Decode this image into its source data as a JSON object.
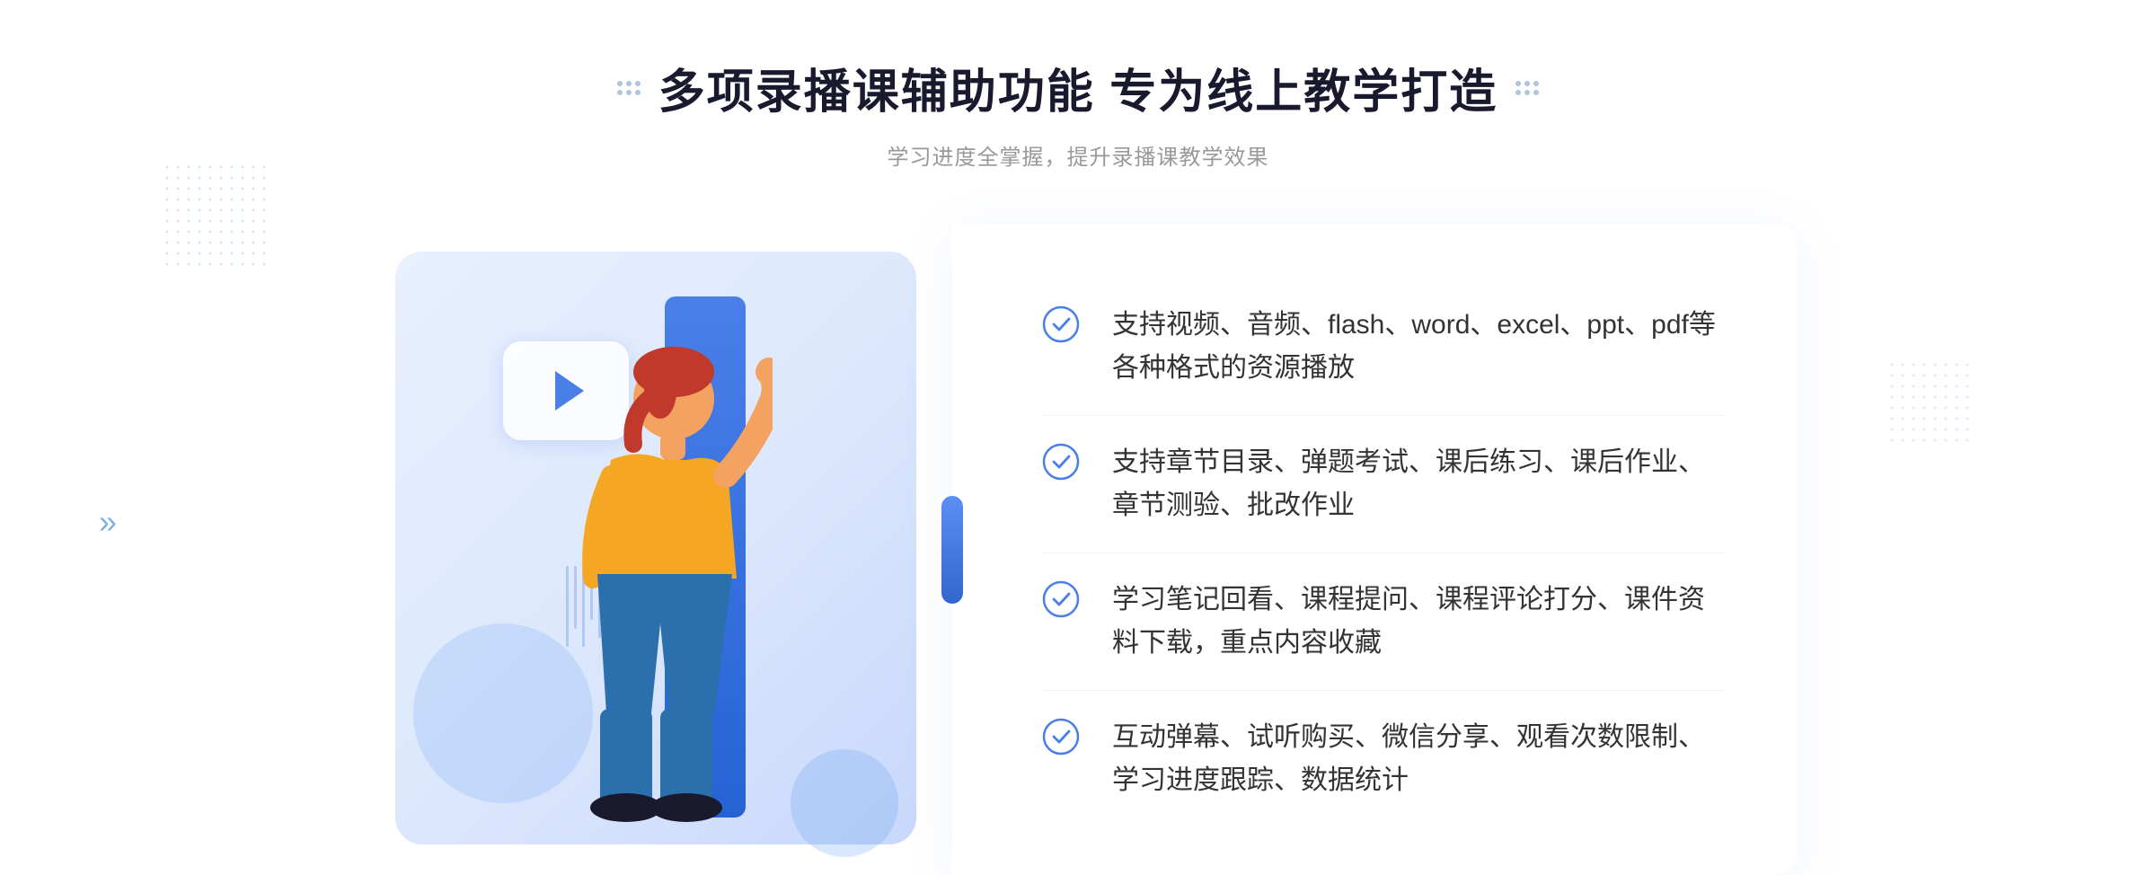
{
  "page": {
    "bg_color": "#ffffff"
  },
  "header": {
    "title": "多项录播课辅助功能 专为线上教学打造",
    "subtitle": "学习进度全掌握，提升录播课教学效果",
    "deco_left": "⁝⁝",
    "deco_right": "⁝⁝"
  },
  "features": [
    {
      "id": 1,
      "text": "支持视频、音频、flash、word、excel、ppt、pdf等各种格式的资源播放"
    },
    {
      "id": 2,
      "text": "支持章节目录、弹题考试、课后练习、课后作业、章节测验、批改作业"
    },
    {
      "id": 3,
      "text": "学习笔记回看、课程提问、课程评论打分、课件资料下载，重点内容收藏"
    },
    {
      "id": 4,
      "text": "互动弹幕、试听购买、微信分享、观看次数限制、学习进度跟踪、数据统计"
    }
  ],
  "decorations": {
    "chevron": "»",
    "check_icon_color": "#4a7fe8",
    "accent_blue": "#3b6fd4"
  }
}
